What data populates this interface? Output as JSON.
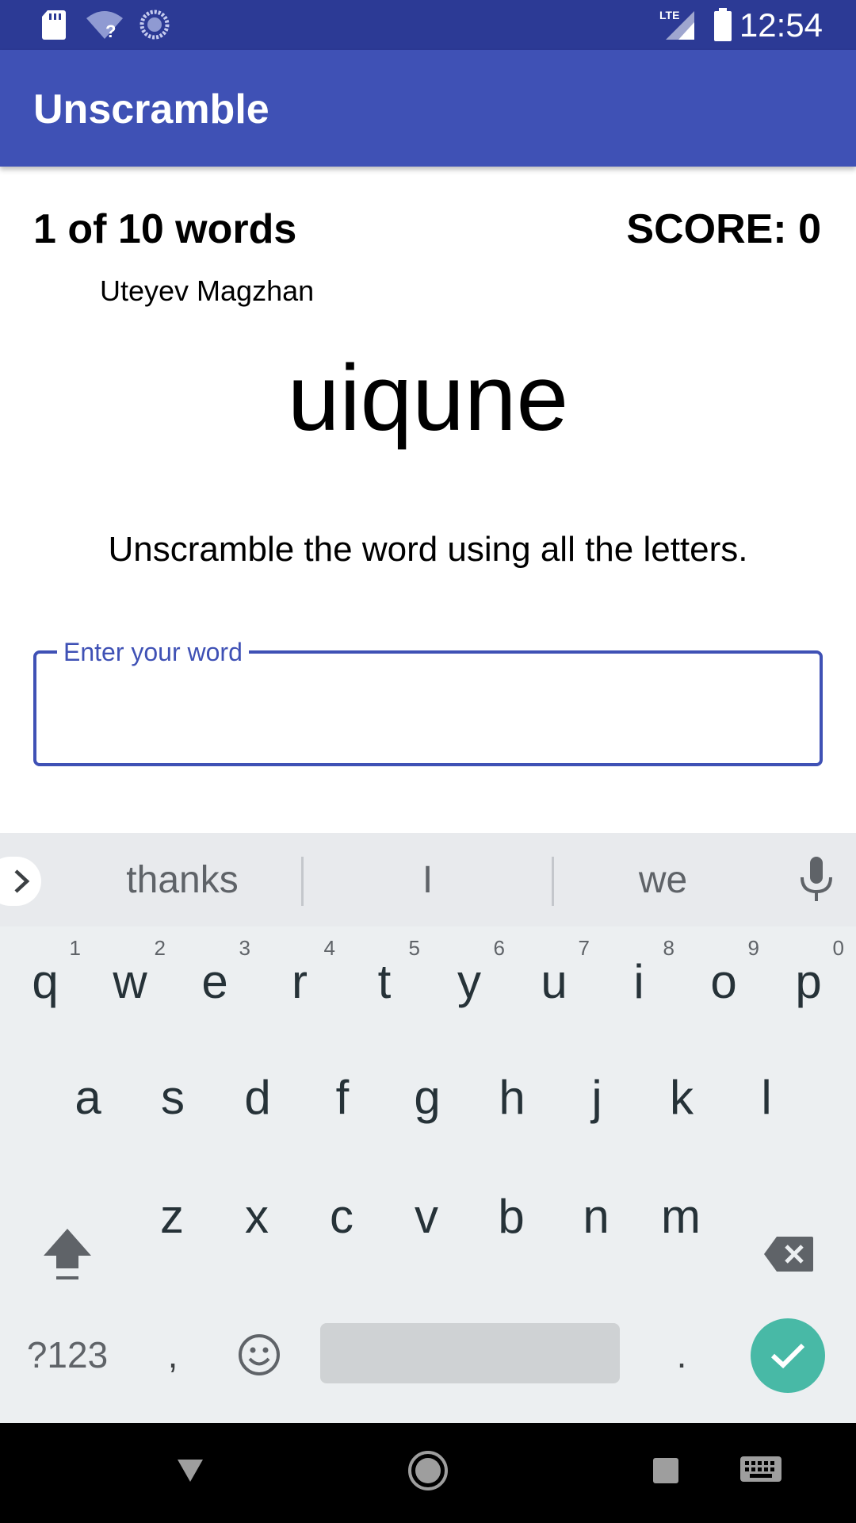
{
  "status_bar": {
    "time": "12:54",
    "network": "LTE",
    "icons": [
      "sd-card-icon",
      "wifi-question-icon",
      "sync-icon",
      "signal-icon",
      "battery-icon"
    ]
  },
  "app_bar": {
    "title": "Unscramble"
  },
  "game": {
    "word_count": "1 of 10 words",
    "score": "SCORE: 0",
    "author": "Uteyev Magzhan",
    "scrambled_word": "uiqune",
    "instructions": "Unscramble the word using all the letters."
  },
  "input": {
    "label": "Enter your word",
    "value": ""
  },
  "keyboard": {
    "suggestions": [
      "thanks",
      "I",
      "we"
    ],
    "row1": [
      {
        "k": "q",
        "h": "1"
      },
      {
        "k": "w",
        "h": "2"
      },
      {
        "k": "e",
        "h": "3"
      },
      {
        "k": "r",
        "h": "4"
      },
      {
        "k": "t",
        "h": "5"
      },
      {
        "k": "y",
        "h": "6"
      },
      {
        "k": "u",
        "h": "7"
      },
      {
        "k": "i",
        "h": "8"
      },
      {
        "k": "o",
        "h": "9"
      },
      {
        "k": "p",
        "h": "0"
      }
    ],
    "row2": [
      "a",
      "s",
      "d",
      "f",
      "g",
      "h",
      "j",
      "k",
      "l"
    ],
    "row3": [
      "z",
      "x",
      "c",
      "v",
      "b",
      "n",
      "m"
    ],
    "symbols_label": "?123",
    "comma": ",",
    "period": "."
  },
  "colors": {
    "status_bar": "#2c3a95",
    "app_bar": "#3f51b5",
    "accent": "#3f51b5",
    "enter_key": "#48b9a6",
    "keyboard_bg": "#eceff1"
  }
}
